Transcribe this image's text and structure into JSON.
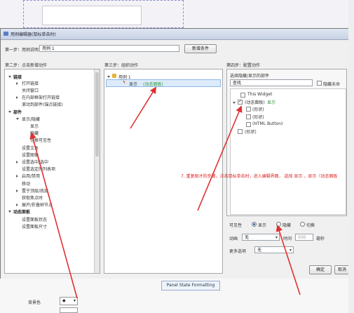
{
  "dialog": {
    "title": "用例编辑器(鼠标单击时)",
    "step1_label": "第一步：用例说明",
    "case_name": "用例 1",
    "add_condition_button": "新增条件",
    "step2_label": "第二步：点击新增动作",
    "step3_label": "第三步：组织动作",
    "step4_label": "第四步：配置动作"
  },
  "actions_tree": {
    "categories": [
      {
        "label": "链接",
        "items": [
          "打开链接",
          "关闭窗口",
          "在内部框架打开链接",
          "滚动到部件(锚点链接)"
        ]
      },
      {
        "label": "部件",
        "items": [
          "显示/隐藏",
          "显示",
          "隐藏",
          "切换可见性",
          "设置文本",
          "设置图像",
          "设置选中/选中",
          "设置选定的列表项",
          "启用/禁用",
          "移动",
          "置于顶层/底层",
          "获取焦点时",
          "展开/折叠树节点"
        ]
      },
      {
        "label": "动态面板",
        "items": [
          "设置面板状态",
          "设置面板尺寸"
        ]
      }
    ]
  },
  "organize": {
    "case": "用例 1",
    "action": "显示",
    "action_target": "(动态面板)"
  },
  "configure": {
    "select_label": "选择隐藏/显示的部件",
    "search_placeholder": "查找",
    "hide_unnamed_label": "隐藏未命",
    "widgets": [
      {
        "label": "This Widget",
        "checked": false
      },
      {
        "label": "(动态面板)",
        "suffix": "显示",
        "checked": true
      },
      {
        "label": "(形状)",
        "checked": false
      },
      {
        "label": "(形状)",
        "checked": false
      },
      {
        "label": "(HTML Button)",
        "checked": false
      },
      {
        "label": "(形状)",
        "checked": false
      }
    ],
    "visibility_label": "可见性",
    "options": [
      "显示",
      "隐藏",
      "切换"
    ],
    "selected_option": "显示",
    "animation_label": "动画",
    "animation_value": "无",
    "time_label": "时间",
    "time_value": "500",
    "ms_label": "毫秒",
    "more_label": "更多选项",
    "more_value": "无"
  },
  "annotation": "7. 重复刚才的步骤，点击鼠标单击时，进入编辑界面， 选择 显示 ，显示（动态面板",
  "buttons": {
    "ok": "确定",
    "cancel": "取消"
  },
  "background": {
    "tab_label": "Panel State Formatting",
    "bg_color_label": "背景色"
  },
  "colors": {
    "annotation": "#e02020",
    "arrow": "#e03030",
    "selected_green": "#2e9a3e"
  }
}
